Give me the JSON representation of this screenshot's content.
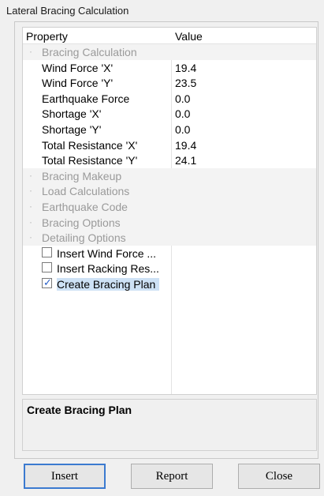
{
  "window": {
    "title": "Lateral Bracing Calculation"
  },
  "grid": {
    "headers": {
      "property": "Property",
      "value": "Value"
    },
    "rows": [
      {
        "kind": "category",
        "name": "Bracing Calculation"
      },
      {
        "kind": "prop",
        "name": "Wind Force 'X'",
        "value": "19.4"
      },
      {
        "kind": "prop",
        "name": "Wind Force 'Y'",
        "value": "23.5"
      },
      {
        "kind": "prop",
        "name": "Earthquake Force",
        "value": "0.0"
      },
      {
        "kind": "prop",
        "name": "Shortage 'X'",
        "value": "0.0"
      },
      {
        "kind": "prop",
        "name": "Shortage 'Y'",
        "value": "0.0"
      },
      {
        "kind": "prop",
        "name": "Total Resistance 'X'",
        "value": "19.4"
      },
      {
        "kind": "prop",
        "name": "Total Resistance 'Y'",
        "value": "24.1"
      },
      {
        "kind": "category",
        "name": "Bracing Makeup"
      },
      {
        "kind": "category",
        "name": "Load Calculations"
      },
      {
        "kind": "category",
        "name": "Earthquake Code"
      },
      {
        "kind": "category",
        "name": "Bracing Options"
      },
      {
        "kind": "category",
        "name": "Detailing Options"
      },
      {
        "kind": "check",
        "name": "Insert Wind Force ...",
        "checked": false
      },
      {
        "kind": "check",
        "name": "Insert Racking Res...",
        "checked": false
      },
      {
        "kind": "check",
        "name": "Create Bracing Plan",
        "checked": true,
        "selected": true
      }
    ]
  },
  "description": {
    "text": "Create Bracing Plan"
  },
  "buttons": {
    "insert": "Insert",
    "report": "Report",
    "close": "Close"
  }
}
